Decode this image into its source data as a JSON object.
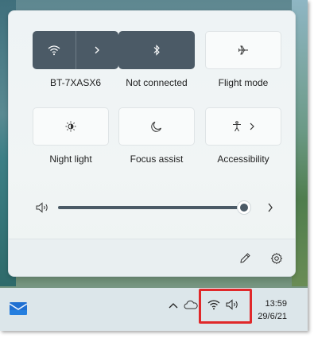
{
  "quick_settings": {
    "tiles": [
      {
        "id": "wifi",
        "label": "BT-7XASX6",
        "active": true,
        "icon": "wifi-icon"
      },
      {
        "id": "bluetooth",
        "label": "Not connected",
        "active": true,
        "icon": "bluetooth-icon"
      },
      {
        "id": "flight",
        "label": "Flight mode",
        "active": false,
        "icon": "airplane-icon"
      },
      {
        "id": "night",
        "label": "Night light",
        "active": false,
        "icon": "brightness-icon"
      },
      {
        "id": "focus",
        "label": "Focus assist",
        "active": false,
        "icon": "moon-icon"
      },
      {
        "id": "access",
        "label": "Accessibility",
        "active": false,
        "icon": "accessibility-icon"
      }
    ],
    "volume": {
      "level": 1.0,
      "icon": "speaker-icon"
    },
    "footer": {
      "edit_icon": "pencil-icon",
      "settings_icon": "gear-icon"
    }
  },
  "taskbar": {
    "time": "13:59",
    "date": "29/6/21",
    "highlight_color": "#e0282a",
    "accent": "#4b5a66"
  }
}
